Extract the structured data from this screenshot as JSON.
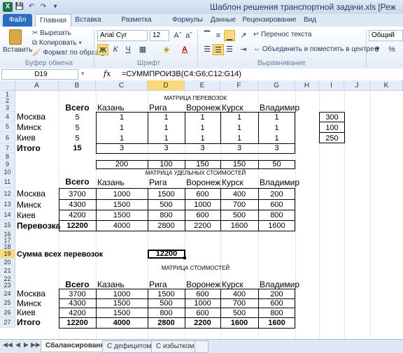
{
  "window": {
    "title": "Шаблон решения транспортной задачи.xls  [Реж"
  },
  "tabs": [
    {
      "label": "Файл"
    },
    {
      "label": "Главная"
    },
    {
      "label": "Вставка"
    },
    {
      "label": "Разметка страницы"
    },
    {
      "label": "Формулы"
    },
    {
      "label": "Данные"
    },
    {
      "label": "Рецензирование"
    },
    {
      "label": "Вид"
    }
  ],
  "ribbon": {
    "paste": "Вставить",
    "cut": "Вырезать",
    "copy": "Копировать",
    "format_painter": "Формат по образцу",
    "clipboard_group": "Буфер обмена",
    "font_name": "Arial Cyr",
    "font_size": "12",
    "font_group": "Шрифт",
    "bold": "Ж",
    "italic": "К",
    "underline": "Ч",
    "wrap_text": "Перенос текста",
    "merge_center": "Объединить и поместить в центре",
    "alignment_group": "Выравнивание",
    "number_format": "Общий",
    "percent": "%"
  },
  "formula_bar": {
    "name_box": "D19",
    "fx": "fx",
    "formula": "=СУММПРОИЗВ(C4:G6;C12:G14)"
  },
  "columns": [
    "A",
    "B",
    "C",
    "D",
    "E",
    "F",
    "G",
    "H",
    "I",
    "J",
    "K"
  ],
  "rows": [
    "1",
    "2",
    "3",
    "4",
    "5",
    "6",
    "7",
    "8",
    "9",
    "10",
    "11",
    "12",
    "13",
    "14",
    "15",
    "16",
    "17",
    "18",
    "19",
    "20",
    "21",
    "22",
    "23",
    "24",
    "25",
    "26",
    "27"
  ],
  "sheet": {
    "t1_title": "МАТРИЦА ПЕРЕВОЗОК",
    "header_total": "Всего",
    "header_cities": [
      "Казань",
      "Рига",
      "Воронеж",
      "Курск",
      "Владимир"
    ],
    "t1_rows": [
      {
        "name": "Москва",
        "total": "5",
        "vals": [
          "1",
          "1",
          "1",
          "1",
          "1"
        ]
      },
      {
        "name": "Минск",
        "total": "5",
        "vals": [
          "1",
          "1",
          "1",
          "1",
          "1"
        ]
      },
      {
        "name": "Киев",
        "total": "5",
        "vals": [
          "1",
          "1",
          "1",
          "1",
          "1"
        ]
      }
    ],
    "t1_sum": {
      "name": "Итого",
      "total": "15",
      "vals": [
        "3",
        "3",
        "3",
        "3",
        "3"
      ]
    },
    "side_vals": [
      "300",
      "100",
      "250"
    ],
    "demand": [
      "200",
      "100",
      "150",
      "150",
      "50"
    ],
    "t2_title": "МАТРИЦА  УДЕЛЬНЫХ СТОИМОСТЕЙ",
    "t2_rows": [
      {
        "name": "Москва",
        "total": "3700",
        "vals": [
          "1000",
          "1500",
          "600",
          "400",
          "200"
        ]
      },
      {
        "name": "Минск",
        "total": "4300",
        "vals": [
          "1500",
          "500",
          "1000",
          "700",
          "600"
        ]
      },
      {
        "name": "Киев",
        "total": "4200",
        "vals": [
          "1500",
          "800",
          "600",
          "500",
          "800"
        ]
      }
    ],
    "t2_sum": {
      "name": "Перевозка",
      "total": "12200",
      "vals": [
        "4000",
        "2800",
        "2200",
        "1600",
        "1600"
      ]
    },
    "sum_label": "Сумма всех перевозок",
    "sum_value": "12200",
    "t3_title": "МАТРИЦА СТОИМОСТЕЙ",
    "t3_rows": [
      {
        "name": "Москва",
        "total": "3700",
        "vals": [
          "1000",
          "1500",
          "600",
          "400",
          "200"
        ]
      },
      {
        "name": "Минск",
        "total": "4300",
        "vals": [
          "1500",
          "500",
          "1000",
          "700",
          "600"
        ]
      },
      {
        "name": "Киев",
        "total": "4200",
        "vals": [
          "1500",
          "800",
          "600",
          "500",
          "800"
        ]
      }
    ],
    "t3_sum": {
      "name": "Итого",
      "total": "12200",
      "vals": [
        "4000",
        "2800",
        "2200",
        "1600",
        "1600"
      ]
    }
  },
  "sheet_tabs": [
    {
      "label": "Сбалансированная"
    },
    {
      "label": "С дефицитом"
    },
    {
      "label": "С избытком"
    }
  ]
}
